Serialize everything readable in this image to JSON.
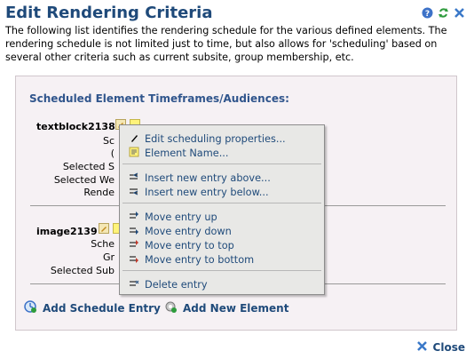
{
  "page": {
    "title": "Edit Rendering Criteria",
    "description": "The following list identifies the rendering schedule for the various defined elements. The rendering schedule is not limited just to time, but also allows for 'scheduling' based on several other criteria such as current subsite, group membership, etc."
  },
  "panel": {
    "heading": "Scheduled Element Timeframes/Audiences:",
    "elements": [
      {
        "name": "textblock2138",
        "row_labels": [
          "Sc",
          "(",
          "Selected S",
          "Selected We",
          "Rende"
        ]
      },
      {
        "name": "image2139",
        "row_labels": [
          "Sche",
          "Gr",
          "Selected Sub"
        ]
      }
    ],
    "add_schedule_label": "Add Schedule Entry",
    "add_element_label": "Add New Element"
  },
  "context_menu": {
    "items": [
      {
        "label": "Edit scheduling properties...",
        "icon": "pencil-icon"
      },
      {
        "label": "Element Name...",
        "icon": "note-icon"
      },
      {
        "label": "Insert new entry above...",
        "icon": "insert-above-icon"
      },
      {
        "label": "Insert new entry below...",
        "icon": "insert-below-icon"
      },
      {
        "label": "Move entry up",
        "icon": "move-up-icon"
      },
      {
        "label": "Move entry down",
        "icon": "move-down-icon"
      },
      {
        "label": "Move entry to top",
        "icon": "move-top-icon"
      },
      {
        "label": "Move entry to bottom",
        "icon": "move-bottom-icon"
      },
      {
        "label": "Delete entry",
        "icon": "delete-entry-icon"
      }
    ]
  },
  "footer": {
    "close_label": "Close"
  },
  "colors": {
    "accent": "#1f4a7a",
    "panel_bg": "#f6f1f4",
    "menu_bg": "#e8e8e6"
  }
}
